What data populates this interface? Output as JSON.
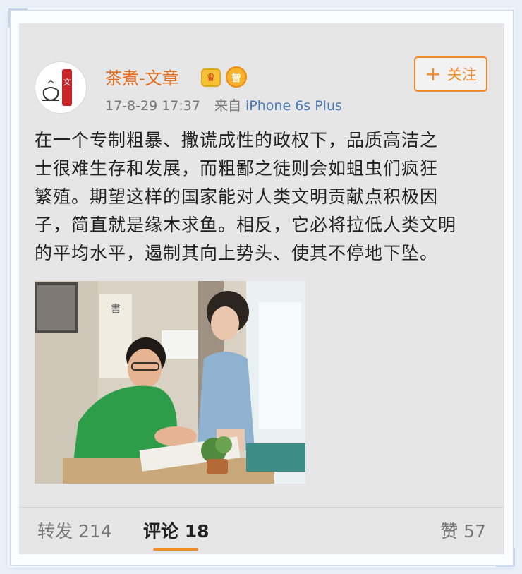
{
  "post": {
    "username": "茶煮-文章",
    "vip_badge": "智",
    "timestamp": "17-8-29 17:37",
    "source_prefix": "来自",
    "source": "iPhone 6s Plus",
    "follow_label": "关注",
    "body_lines": [
      "在一个专制粗暴、撒谎成性的政权下，品质高洁之",
      "士很难生存和发展，而粗鄙之徒则会如蛆虫们疯狂",
      "繁殖。期望这样的国家能对人类文明贡献点积极因",
      "子，简直就是缘木求鱼。相反，它必将拉低人类文明",
      "的平均水平，遏制其向上势头、使其不停地下坠。"
    ],
    "avatar_text": "文"
  },
  "actions": {
    "repost": "转发 214",
    "comment": "评论 18",
    "like": "赞 57"
  },
  "colors": {
    "accent": "#f08a2c",
    "username": "#e46d1c",
    "link": "#4a79b7"
  }
}
